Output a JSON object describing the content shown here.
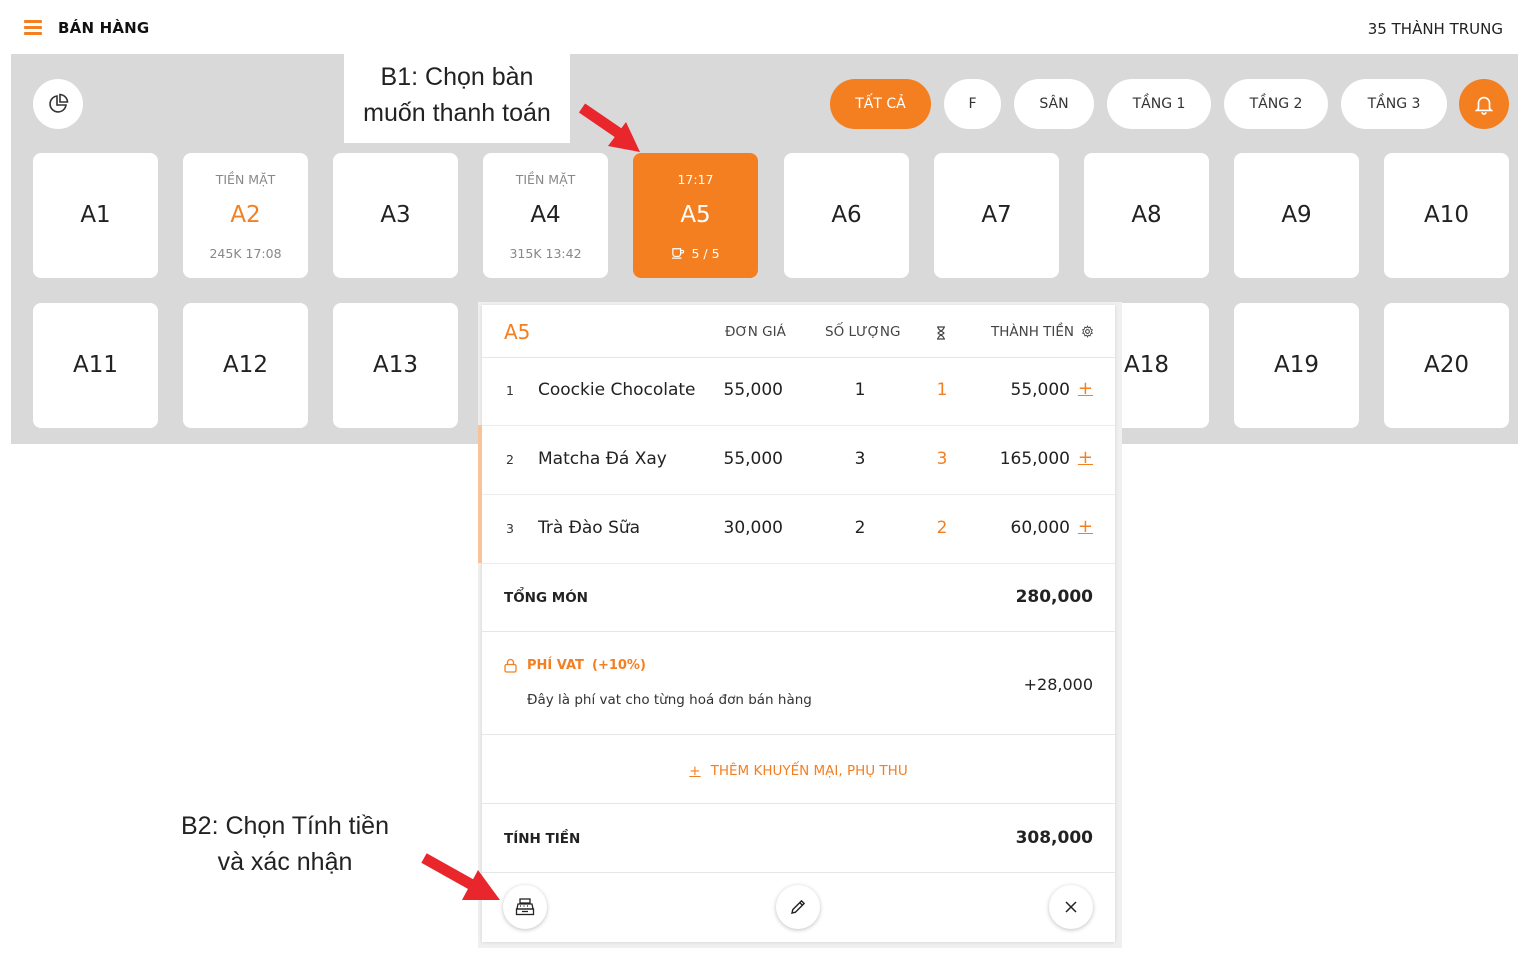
{
  "header": {
    "title": "BÁN HÀNG",
    "user": "35 THÀNH TRUNG"
  },
  "filters": [
    {
      "label": "TẤT CẢ",
      "active": true
    },
    {
      "label": "F",
      "active": false
    },
    {
      "label": "SÂN",
      "active": false
    },
    {
      "label": "TẦNG 1",
      "active": false
    },
    {
      "label": "TẦNG 2",
      "active": false
    },
    {
      "label": "TẦNG 3",
      "active": false
    }
  ],
  "tables": [
    {
      "name": "A1"
    },
    {
      "name": "A2",
      "top": "TIỀN MẶT",
      "bottom": "245K 17:08",
      "status": "busy"
    },
    {
      "name": "A3"
    },
    {
      "name": "A4",
      "top": "TIỀN MẶT",
      "bottom": "315K 13:42"
    },
    {
      "name": "A5",
      "top": "17:17",
      "bottom": "5 / 5",
      "status": "selected"
    },
    {
      "name": "A6"
    },
    {
      "name": "A7"
    },
    {
      "name": "A8"
    },
    {
      "name": "A9"
    },
    {
      "name": "A10"
    },
    {
      "name": "A11"
    },
    {
      "name": "A12"
    },
    {
      "name": "A13"
    },
    {
      "name": "A18"
    },
    {
      "name": "A19"
    },
    {
      "name": "A20"
    }
  ],
  "annotations": {
    "step1_line1": "B1: Chọn bàn",
    "step1_line2": "muốn thanh toán",
    "step2_line1": "B2: Chọn Tính tiền",
    "step2_line2": "và xác nhận"
  },
  "order": {
    "table": "A5",
    "columns": {
      "price": "ĐƠN GIÁ",
      "qty": "SỐ LƯỢNG",
      "amount": "THÀNH TIỀN"
    },
    "items": [
      {
        "index": "1",
        "name": "Coockie Chocolate",
        "price": "55,000",
        "qty": "1",
        "wait": "1",
        "amount": "55,000"
      },
      {
        "index": "2",
        "name": "Matcha Đá Xay",
        "price": "55,000",
        "qty": "3",
        "wait": "3",
        "amount": "165,000"
      },
      {
        "index": "3",
        "name": "Trà Đào Sữa",
        "price": "30,000",
        "qty": "2",
        "wait": "2",
        "amount": "60,000"
      }
    ],
    "total_label": "TỔNG MÓN",
    "total_value": "280,000",
    "vat_name": "PHÍ VAT",
    "vat_rate": "(+10%)",
    "vat_desc": "Đây là phí vat cho từng hoá đơn bán hàng",
    "vat_value": "+28,000",
    "promo_label": "THÊM KHUYẾN MẠI, PHỤ THU",
    "pay_label": "TÍNH TIỀN",
    "pay_value": "308,000"
  },
  "colors": {
    "accent": "#f47f20",
    "floor": "#d9d9d9",
    "arrow": "#e8262b"
  },
  "icons": [
    "menu-icon",
    "pie-chart-icon",
    "bell-icon",
    "cup-icon",
    "hourglass-icon",
    "gear-icon",
    "lock-icon",
    "plus-icon",
    "cash-register-icon",
    "pencil-icon",
    "close-icon"
  ]
}
